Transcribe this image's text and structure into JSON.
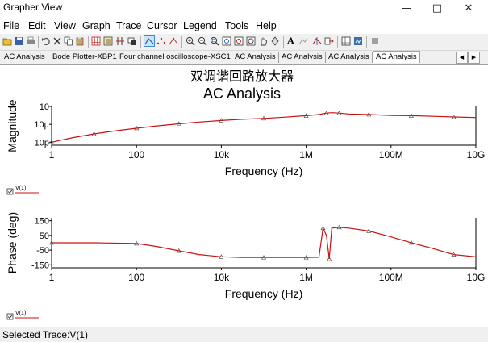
{
  "window": {
    "title": "Grapher View"
  },
  "menu": [
    "File",
    "Edit",
    "View",
    "Graph",
    "Trace",
    "Cursor",
    "Legend",
    "Tools",
    "Help"
  ],
  "tabs": [
    "AC Analysis",
    "Bode Plotter-XBP1",
    "Four channel oscilloscope-XSC1",
    "AC Analysis",
    "AC Analysis",
    "AC Analysis",
    "AC Analysis"
  ],
  "active_tab": 6,
  "graph": {
    "title_cn": "双调谐回路放大器",
    "title": "AC Analysis"
  },
  "legend_trace": "V(1)",
  "status": "Selected Trace:V(1)",
  "colors": {
    "trace": "#cc1111",
    "accent": "#1e78c8"
  },
  "chart_data": [
    {
      "type": "line",
      "ylabel": "Magnitude",
      "xlabel": "Frequency (Hz)",
      "x_scale": "log",
      "y_scale": "log",
      "x_ticks": [
        "1",
        "100",
        "10k",
        "1M",
        "100M",
        "10G"
      ],
      "y_ticks": [
        "10p",
        "10µ",
        "10"
      ],
      "xlim": [
        1,
        10000000000
      ],
      "series": [
        {
          "x": [
            1,
            3,
            10,
            30,
            100,
            300,
            1000,
            3000,
            10000,
            30000,
            100000,
            300000,
            1000000,
            2000000,
            3000000,
            4000000,
            6000000,
            10000000,
            30000000,
            100000000,
            300000000,
            1000000000,
            3000000000,
            10000000000
          ],
          "y": [
            1e-11,
            3e-10,
            6e-09,
            6e-08,
            5e-07,
            3e-06,
            1.5e-05,
            6e-05,
            0.0002,
            0.0005,
            0.001,
            0.0025,
            0.008,
            0.02,
            0.06,
            0.08,
            0.06,
            0.03,
            0.02,
            0.01,
            0.008,
            0.005,
            0.003,
            0.002
          ]
        }
      ]
    },
    {
      "type": "line",
      "ylabel": "Phase (deg)",
      "xlabel": "Frequency (Hz)",
      "x_scale": "log",
      "x_ticks": [
        "1",
        "100",
        "10k",
        "1M",
        "100M",
        "10G"
      ],
      "y_ticks": [
        "150",
        "50",
        "-50",
        "-150"
      ],
      "xlim": [
        1,
        10000000000
      ],
      "ylim": [
        -170,
        170
      ],
      "series": [
        {
          "x": [
            1,
            10,
            100,
            300,
            1000,
            3000,
            10000,
            30000,
            100000,
            300000,
            1000000,
            2000000,
            2500000,
            3000000,
            3500000,
            4000000,
            6000000,
            10000000,
            30000000,
            100000000,
            300000000,
            1000000000,
            3000000000,
            10000000000
          ],
          "y": [
            0,
            0,
            -5,
            -25,
            -55,
            -80,
            -95,
            -100,
            -100,
            -100,
            -100,
            -98,
            100,
            50,
            -110,
            100,
            105,
            100,
            80,
            40,
            0,
            -40,
            -80,
            -95
          ]
        }
      ]
    }
  ]
}
